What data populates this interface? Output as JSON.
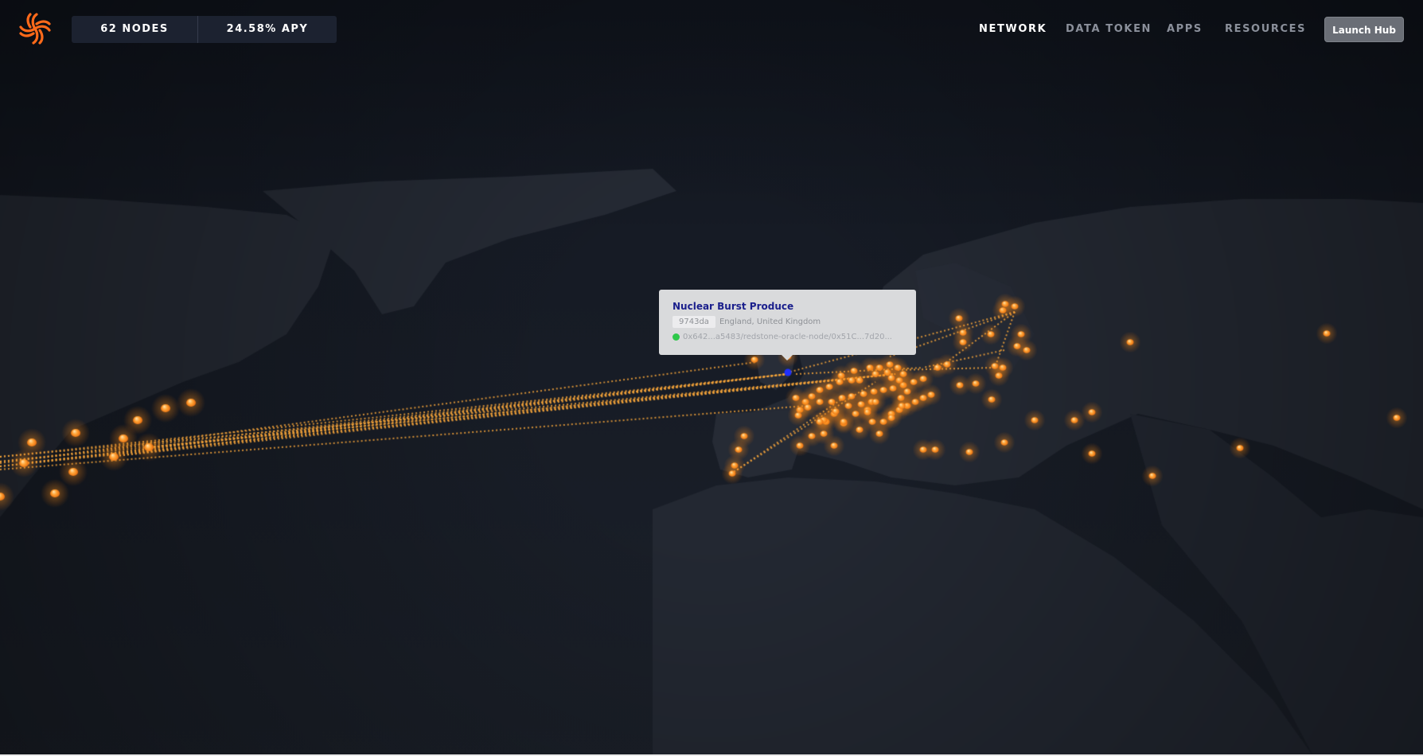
{
  "header": {
    "logo_icon": "streamr-logo-icon",
    "stats": {
      "nodes": "62 NODES",
      "apy": "24.58% APY"
    },
    "nav": [
      {
        "label": "NETWORK",
        "active": true
      },
      {
        "label": "DATA TOKEN",
        "active": false
      },
      {
        "label": "APPS",
        "active": false
      },
      {
        "label": "RESOURCES",
        "active": false
      }
    ],
    "launch_button": "Launch Hub"
  },
  "tooltip": {
    "title": "Nuclear Burst Produce",
    "node_id": "9743da",
    "location": "England, United Kingdom",
    "status_color": "#2ec84a",
    "address": "0x642...a5483/redstone-oracle-node/0x51C...7d20..."
  },
  "colors": {
    "background": "#121722",
    "node": "#ff9a2a",
    "selected_node": "#2030ff",
    "link": "#f2a23a"
  }
}
